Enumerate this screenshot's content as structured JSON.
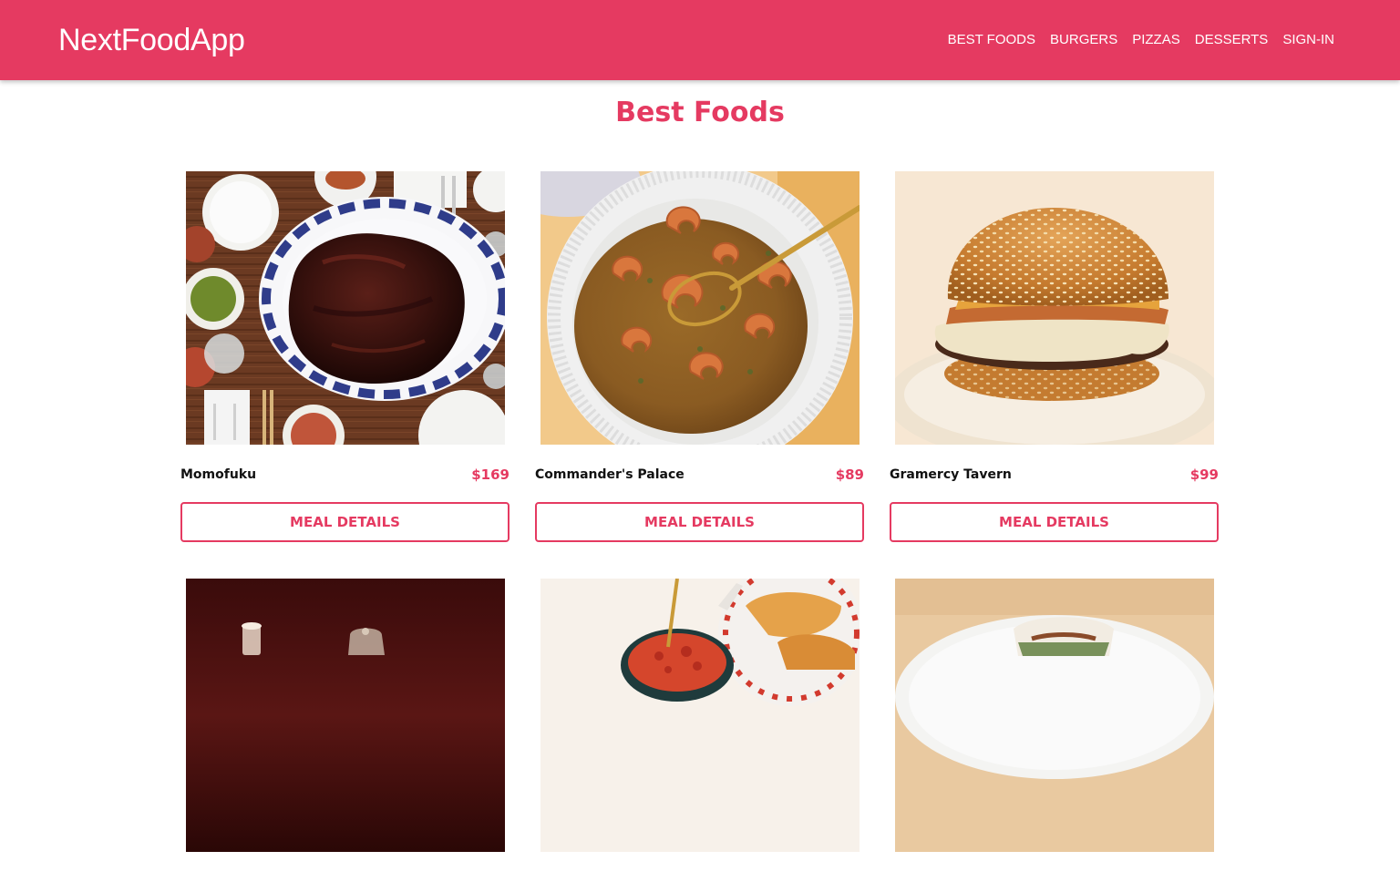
{
  "navbar": {
    "brand": "NextFoodApp",
    "links": [
      "BEST FOODS",
      "BURGERS",
      "PIZZAS",
      "DESSERTS",
      "SIGN-IN"
    ]
  },
  "page": {
    "title": "Best Foods"
  },
  "colors": {
    "brand": "#e53a61",
    "background": "#ffffff",
    "text": "#111111"
  },
  "meals": [
    {
      "name": "Momofuku",
      "price": "$169",
      "button": "MEAL DETAILS",
      "image": "roasted-pork-shoulder-photo"
    },
    {
      "name": "Commander's Palace",
      "price": "$89",
      "button": "MEAL DETAILS",
      "image": "shrimp-gumbo-bowl-photo"
    },
    {
      "name": "Gramercy Tavern",
      "price": "$99",
      "button": "MEAL DETAILS",
      "image": "sesame-bacon-cheeseburger-photo"
    },
    {
      "name": "",
      "price": "",
      "button": "",
      "image": "dark-dining-table-candle-photo"
    },
    {
      "name": "",
      "price": "",
      "button": "",
      "image": "salsa-bowl-empanadas-photo"
    },
    {
      "name": "",
      "price": "",
      "button": "",
      "image": "bao-bun-plate-photo"
    }
  ]
}
